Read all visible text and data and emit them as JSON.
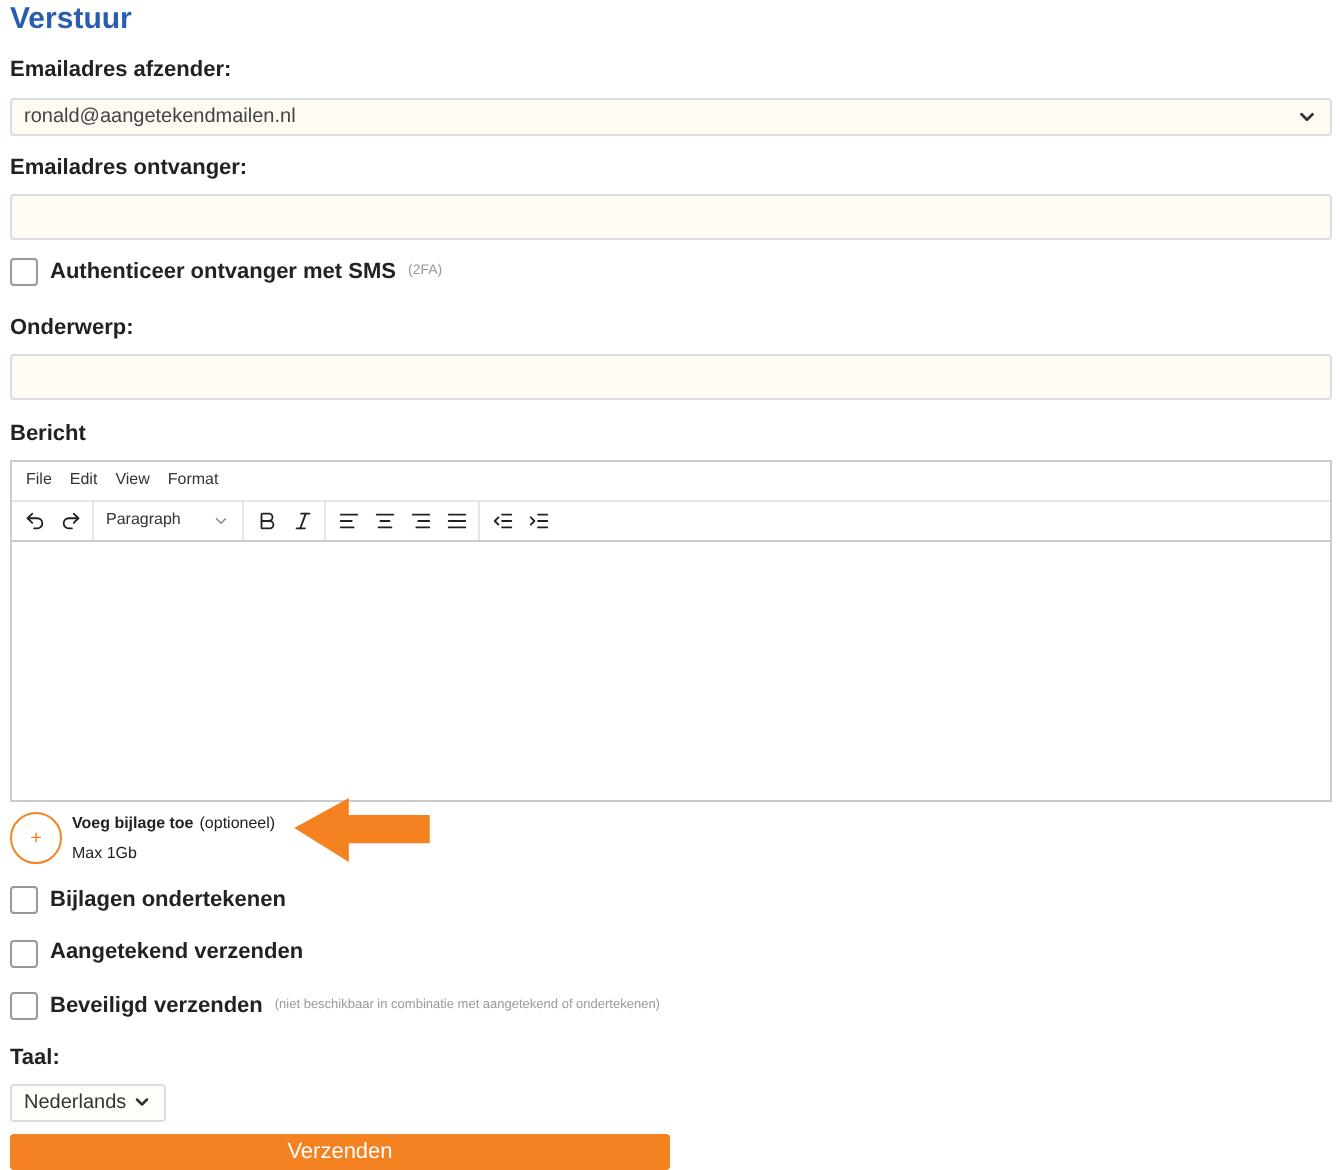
{
  "title": "Verstuur",
  "sender": {
    "label": "Emailadres afzender:",
    "value": "ronald@aangetekendmailen.nl"
  },
  "recipient": {
    "label": "Emailadres ontvanger:"
  },
  "sms_2fa": {
    "label": "Authenticeer ontvanger met SMS",
    "note": "(2FA)",
    "checked": false
  },
  "subject": {
    "label": "Onderwerp:"
  },
  "message": {
    "label": "Bericht",
    "menu": [
      "File",
      "Edit",
      "View",
      "Format"
    ],
    "block_format": "Paragraph"
  },
  "attachment": {
    "label": "Voeg bijlage toe",
    "note": "(optioneel)",
    "max": "Max 1Gb",
    "plus": "+"
  },
  "options": [
    {
      "label": "Bijlagen ondertekenen",
      "checked": false
    },
    {
      "label": "Aangetekend verzenden",
      "checked": false
    },
    {
      "label": "Beveiligd verzenden",
      "note": "(niet beschikbaar in combinatie met aangetekend of ondertekenen)",
      "checked": false
    }
  ],
  "language": {
    "label": "Taal:",
    "value": "Nederlands"
  },
  "submit": "Verzenden"
}
